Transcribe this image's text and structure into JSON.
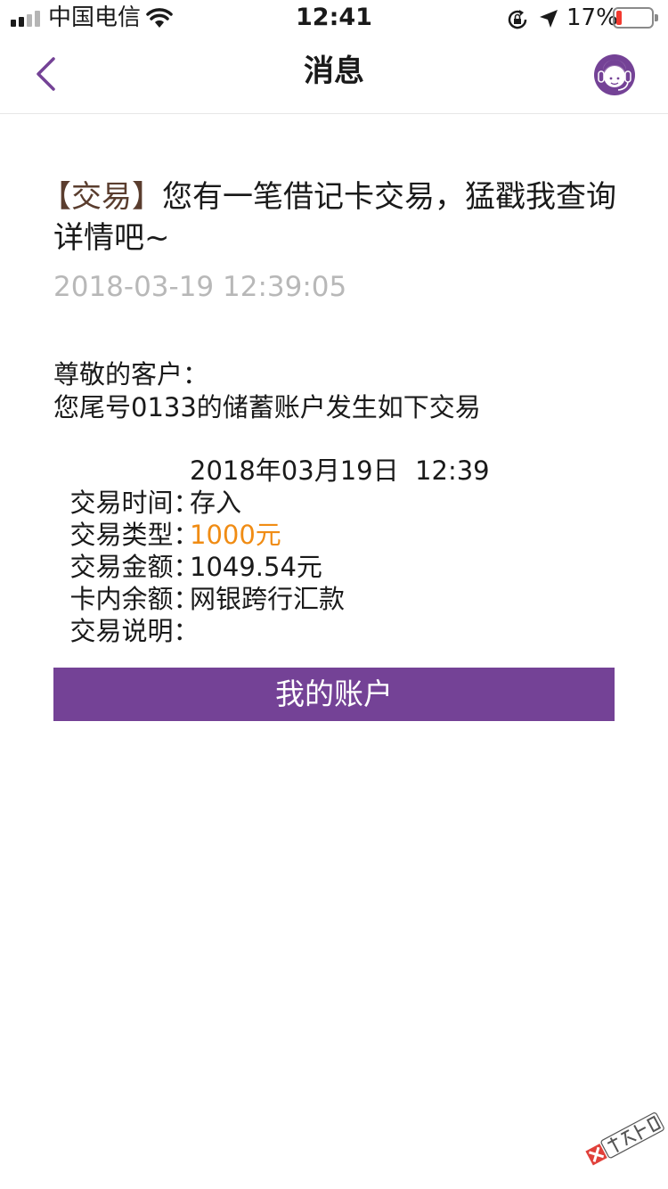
{
  "status_bar": {
    "carrier": "中国电信",
    "time": "12:41",
    "battery_percent": "17%",
    "battery_level": 0.17,
    "signal_bars_filled": 2,
    "signal_bars_total": 4,
    "icons": [
      "signal-icon",
      "wifi-icon",
      "rotation-lock-icon",
      "location-icon",
      "battery-icon"
    ]
  },
  "nav": {
    "title": "消息",
    "back_icon": "chevron-left-icon",
    "service_icon": "customer-service-icon"
  },
  "message": {
    "tag": "【交易】",
    "title": "您有一笔借记卡交易，猛戳我查询详情吧~",
    "datetime": "2018-03-19 12:39:05",
    "greeting": "尊敬的客户：",
    "intro": "您尾号0133的储蓄账户发生如下交易",
    "details": [
      {
        "label": "交易时间：",
        "value": "2018年03月19日  12:39",
        "highlight": false
      },
      {
        "label": "交易类型：",
        "value": "存入",
        "highlight": false
      },
      {
        "label": "交易金额：",
        "value": "1000元",
        "highlight": true
      },
      {
        "label": "卡内余额：",
        "value": "1049.54元",
        "highlight": false
      },
      {
        "label": "交易说明：",
        "value": "网银跨行汇款",
        "highlight": false
      }
    ]
  },
  "button": {
    "label": "我的账户"
  },
  "watermark": {
    "text": "卡农社区"
  },
  "colors": {
    "accent": "#744296",
    "amount": "#f08c14",
    "date": "#b8b8b8",
    "tag": "#5a3d2e",
    "battery_low": "#f23a2f"
  }
}
